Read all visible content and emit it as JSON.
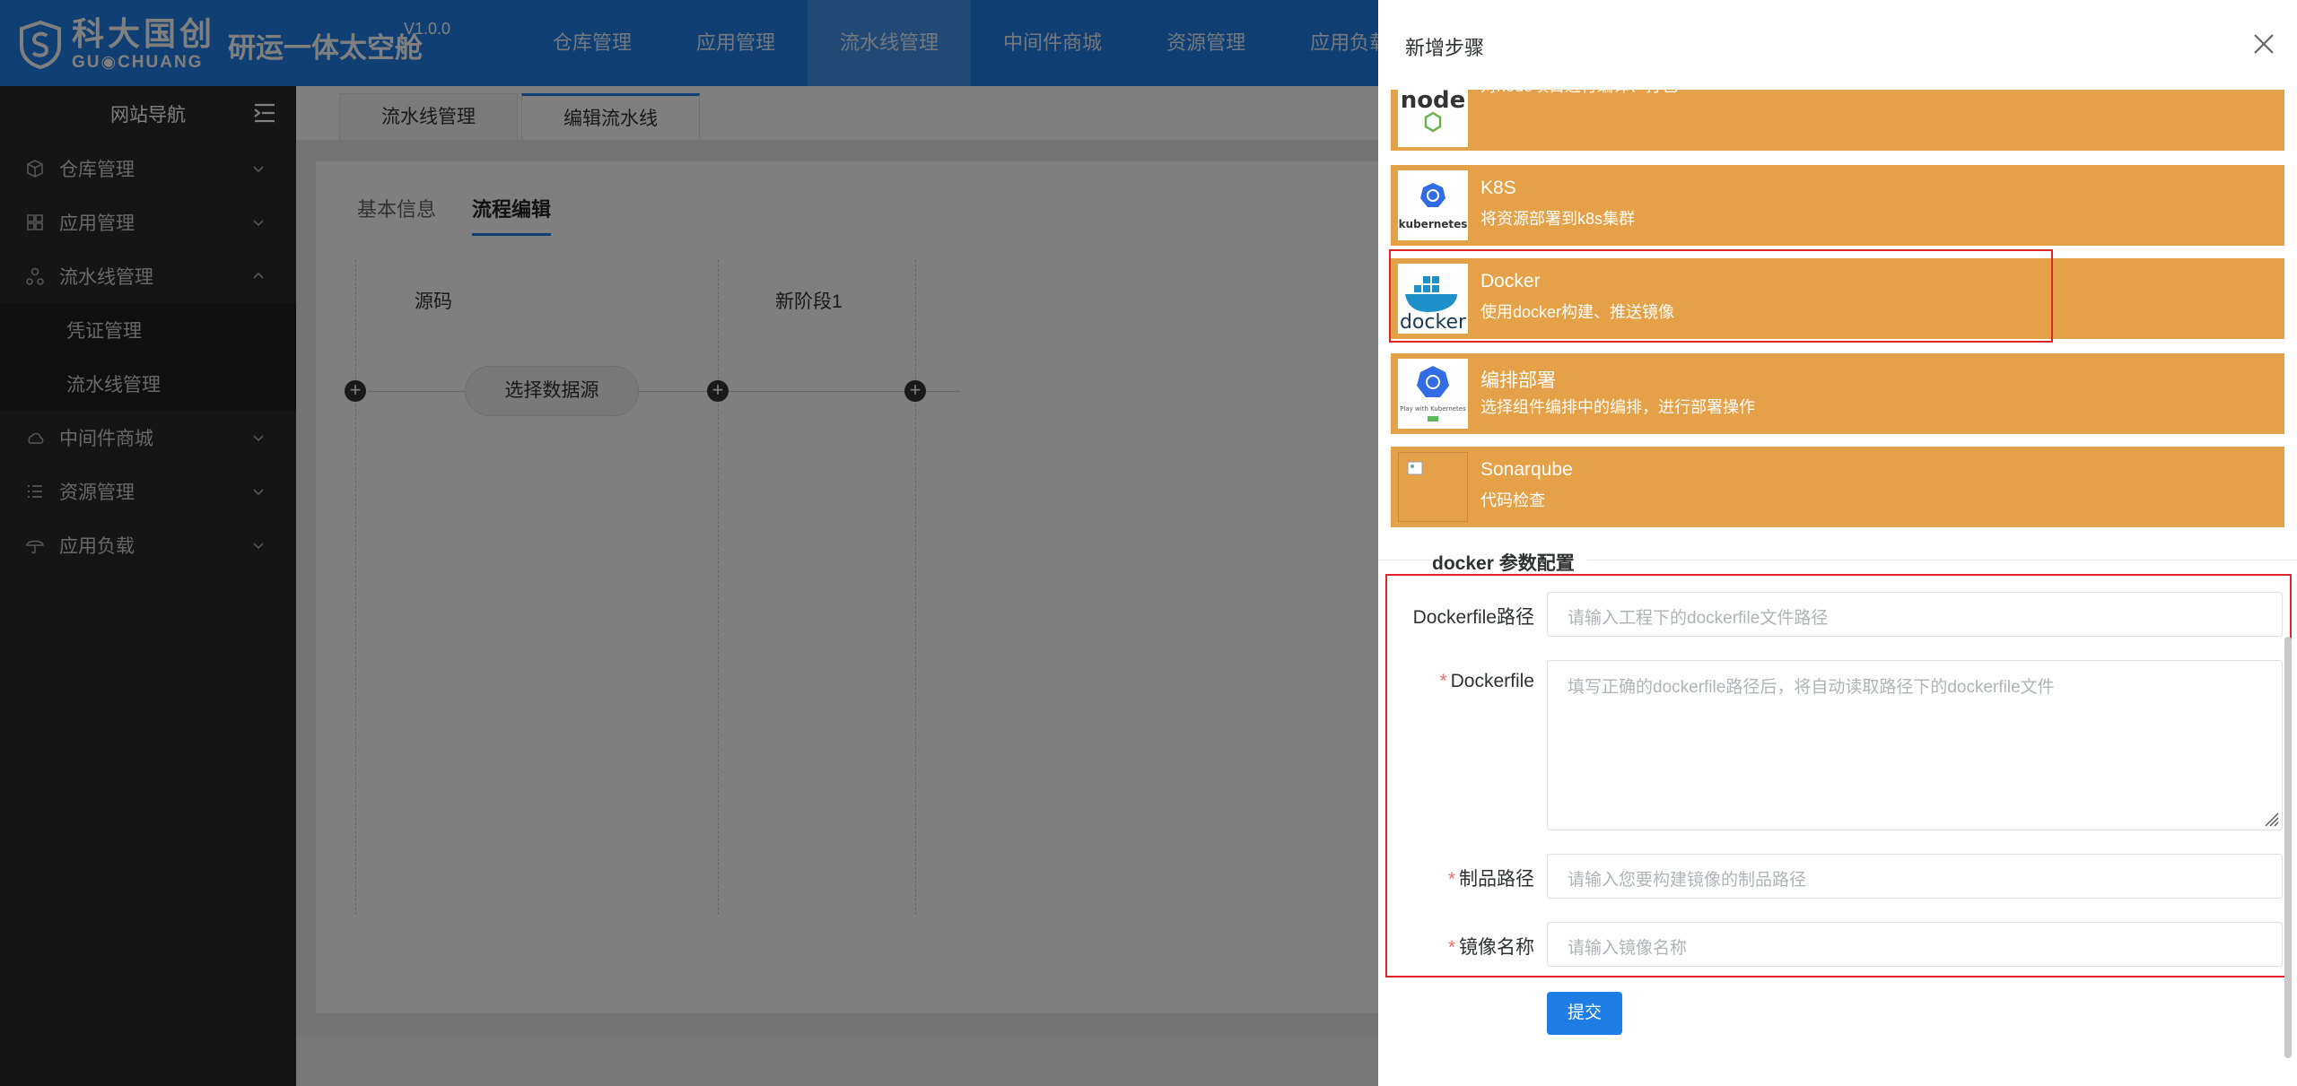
{
  "app": {
    "logo_cn": "科大国创",
    "logo_en": "GU◉CHUANG",
    "title": "研运一体太空舱",
    "version": "V1.0.0"
  },
  "topnav": [
    "仓库管理",
    "应用管理",
    "流水线管理",
    "中间件商城",
    "资源管理",
    "应用负载"
  ],
  "sidebar": {
    "title": "网站导航",
    "items": [
      {
        "label": "仓库管理",
        "icon": "cube-icon"
      },
      {
        "label": "应用管理",
        "icon": "grid-icon"
      },
      {
        "label": "流水线管理",
        "icon": "pipeline-icon",
        "expanded": true
      },
      {
        "label": "凭证管理"
      },
      {
        "label": "流水线管理"
      },
      {
        "label": "中间件商城",
        "icon": "cloud-icon"
      },
      {
        "label": "资源管理",
        "icon": "list-icon"
      },
      {
        "label": "应用负载",
        "icon": "umbrella-icon"
      }
    ]
  },
  "content": {
    "tabs": [
      "流水线管理",
      "编辑流水线"
    ],
    "subtabs": [
      "基本信息",
      "流程编辑"
    ],
    "stages": [
      "源码",
      "新阶段1"
    ],
    "source_button": "选择数据源"
  },
  "drawer": {
    "title": "新增步骤",
    "steps": [
      {
        "name": "",
        "desc": "对node项目进行编译、打包",
        "icon": "node-logo-icon",
        "logo_text": "node"
      },
      {
        "name": "K8S",
        "desc": "将资源部署到k8s集群",
        "icon": "kubernetes-logo-icon",
        "logo_text": "kubernetes"
      },
      {
        "name": "Docker",
        "desc": "使用docker构建、推送镜像",
        "icon": "docker-logo-icon",
        "logo_text": "docker"
      },
      {
        "name": "编排部署",
        "desc": "选择组件编排中的编排，进行部署操作",
        "icon": "play-with-kubernetes-icon",
        "logo_text": "Play with Kubernetes"
      },
      {
        "name": "Sonarqube",
        "desc": "代码检查",
        "icon": "broken-image-icon"
      }
    ],
    "section_title": "docker 参数配置",
    "form": {
      "dockerfile_path_label": "Dockerfile路径",
      "dockerfile_path_placeholder": "请输入工程下的dockerfile文件路径",
      "dockerfile_label": "Dockerfile",
      "dockerfile_placeholder": "填写正确的dockerfile路径后，将自动读取路径下的dockerfile文件",
      "artifact_path_label": "制品路径",
      "artifact_path_placeholder": "请输入您要构建镜像的制品路径",
      "image_name_label": "镜像名称",
      "image_name_placeholder": "请输入镜像名称",
      "required_mark": "*",
      "submit_label": "提交"
    }
  },
  "colors": {
    "primary": "#1e7ee6",
    "step_bg": "#e5a147",
    "highlight": "#e0242c",
    "sidebar_bg": "#2b2b2b"
  }
}
